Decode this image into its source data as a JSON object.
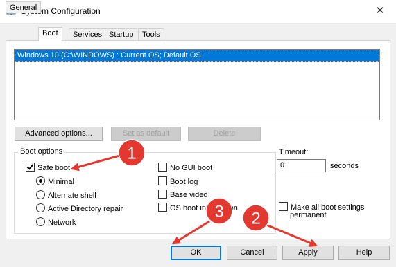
{
  "window": {
    "title": "System Configuration",
    "close_glyph": "✕"
  },
  "tabs": [
    {
      "label": "General"
    },
    {
      "label": "Boot"
    },
    {
      "label": "Services"
    },
    {
      "label": "Startup"
    },
    {
      "label": "Tools"
    }
  ],
  "os_list": {
    "items": [
      "Windows 10 (C:\\WINDOWS) : Current OS; Default OS"
    ]
  },
  "os_buttons": {
    "advanced": "Advanced options...",
    "set_default": "Set as default",
    "delete": "Delete"
  },
  "boot_options": {
    "label": "Boot options",
    "safe_boot": {
      "label": "Safe boot",
      "checked": true
    },
    "radios": [
      {
        "label": "Minimal",
        "checked": true
      },
      {
        "label": "Alternate shell",
        "checked": false
      },
      {
        "label": "Active Directory repair",
        "checked": false
      },
      {
        "label": "Network",
        "checked": false
      }
    ],
    "checks": [
      {
        "label": "No GUI boot",
        "checked": false
      },
      {
        "label": "Boot log",
        "checked": false
      },
      {
        "label": "Base video",
        "checked": false
      },
      {
        "label": "OS boot information",
        "checked": false
      }
    ]
  },
  "timeout": {
    "label": "Timeout:",
    "value": "0",
    "unit": "seconds"
  },
  "make_permanent": {
    "line1": "Make all boot settings",
    "line2": "permanent",
    "checked": false
  },
  "footer": {
    "ok": "OK",
    "cancel": "Cancel",
    "apply": "Apply",
    "help": "Help"
  },
  "annotations": {
    "badge1": "1",
    "badge2": "2",
    "badge3": "3",
    "color": "#e2382f"
  }
}
